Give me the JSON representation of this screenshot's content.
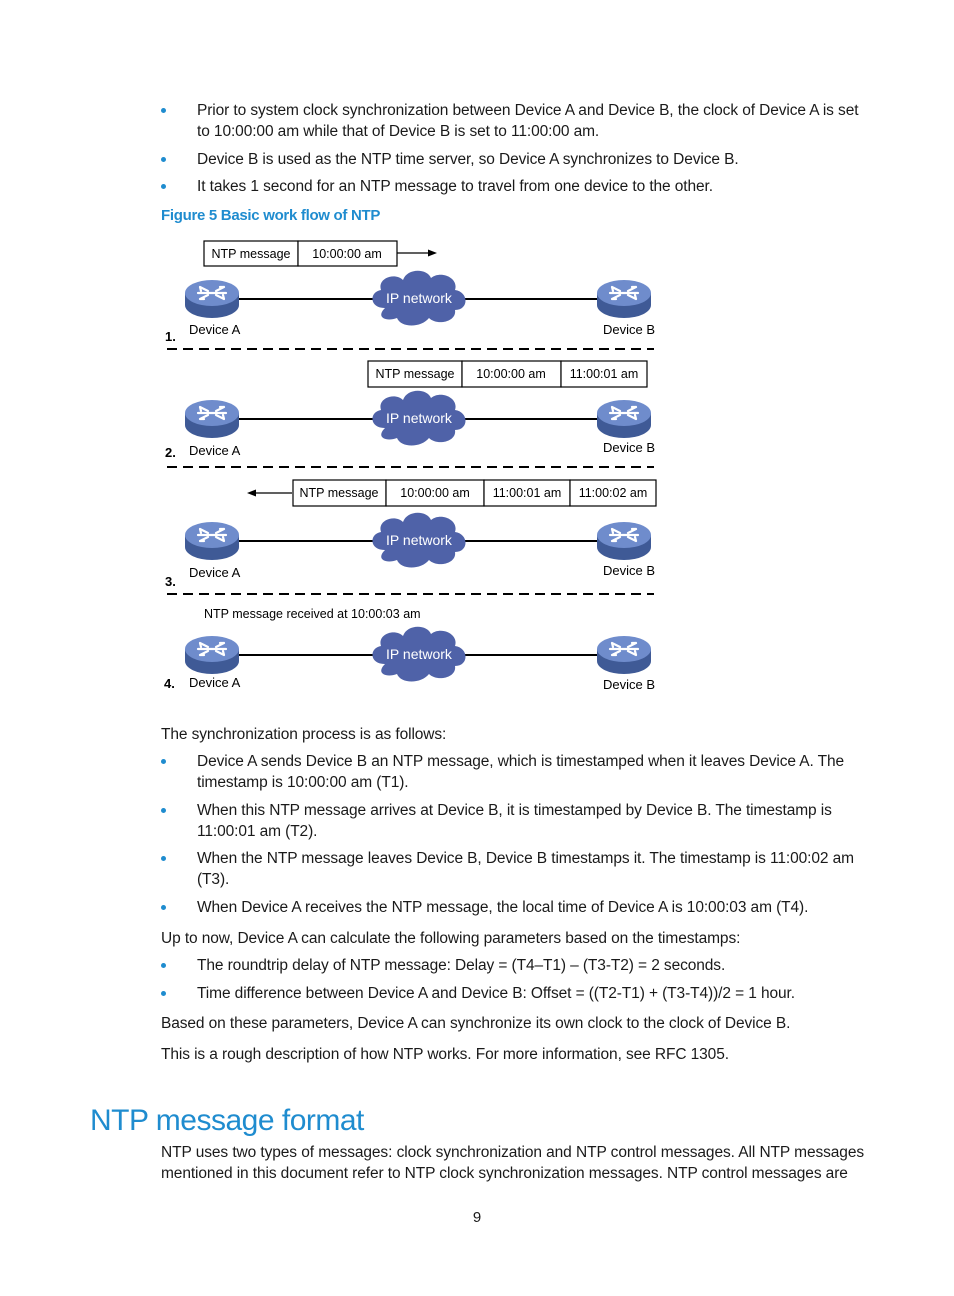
{
  "intro_bullets": [
    "Prior to system clock synchronization between Device A and Device B, the clock of Device A is set to 10:00:00 am while that of Device B is set to 11:00:00 am.",
    "Device B is used as the NTP time server, so Device A synchronizes to Device B.",
    "It takes 1 second for an NTP message to travel from one device to the other."
  ],
  "figure": {
    "caption": "Figure 5 Basic work flow of NTP",
    "network_label": "IP network",
    "device_a": "Device A",
    "device_b": "Device B",
    "steps": [
      {
        "num": "1.",
        "message_cells": [
          "NTP message",
          "10:00:00 am"
        ],
        "arrow": "right"
      },
      {
        "num": "2.",
        "message_cells": [
          "NTP message",
          "10:00:00 am",
          "11:00:01 am"
        ],
        "arrow": "none"
      },
      {
        "num": "3.",
        "message_cells": [
          "NTP message",
          "10:00:00 am",
          "11:00:01 am",
          "11:00:02 am"
        ],
        "arrow": "left"
      },
      {
        "num": "4.",
        "note": "NTP message received at 10:00:03 am"
      }
    ],
    "colors": {
      "device": "#5b78b8",
      "cloud": "#4f62a8",
      "cloud_text": "#ffffff"
    }
  },
  "sync_intro": "The synchronization process is as follows:",
  "sync_bullets": [
    "Device A sends Device B an NTP message, which is timestamped when it leaves Device A. The timestamp is 10:00:00 am (T1).",
    "When this NTP message arrives at Device B, it is timestamped by Device B. The timestamp is 11:00:01 am (T2).",
    "When the NTP message leaves Device B, Device B timestamps it. The timestamp is 11:00:02 am (T3).",
    "When Device A receives the NTP message, the local time of Device A is 10:00:03 am (T4)."
  ],
  "calc_intro": "Up to now, Device A can calculate the following parameters based on the timestamps:",
  "calc_bullets": [
    "The roundtrip delay of NTP message: Delay = (T4–T1) – (T3-T2) = 2 seconds.",
    "Time difference between Device A and Device B: Offset = ((T2-T1) + (T3-T4))/2 = 1 hour."
  ],
  "conclusion_1": "Based on these parameters, Device A can synchronize its own clock to the clock of Device B.",
  "conclusion_2": "This is a rough description of how NTP works. For more information, see RFC 1305.",
  "section_heading": "NTP message format",
  "section_para": "NTP uses two types of messages: clock synchronization and NTP control messages. All NTP messages mentioned in this document refer to NTP clock synchronization messages. NTP control messages are",
  "page_number": "9",
  "accent_color": "#1f8ccf"
}
